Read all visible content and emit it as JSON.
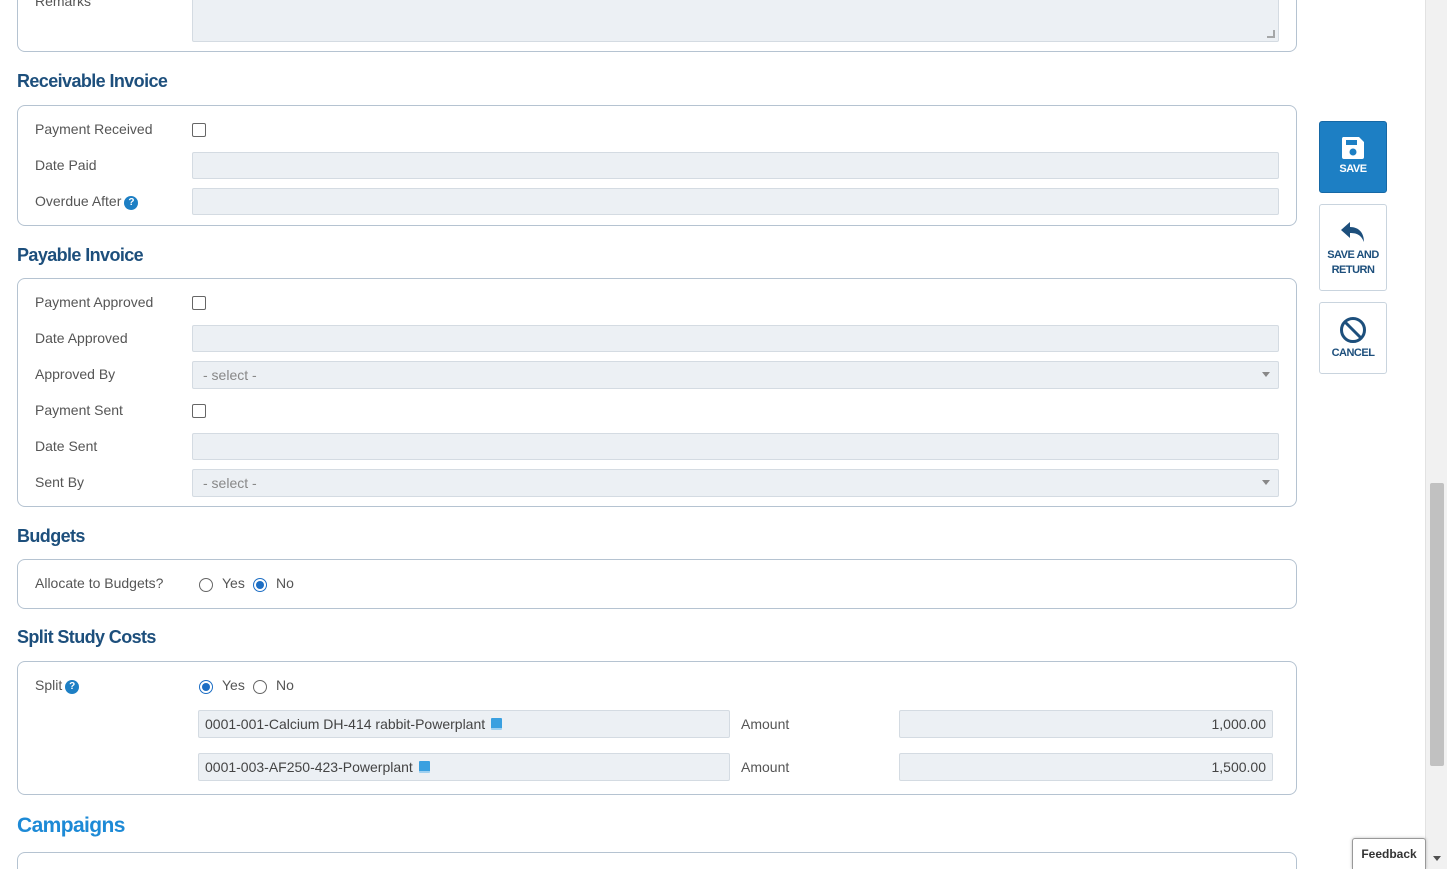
{
  "remarks": {
    "label": "Remarks"
  },
  "receivable": {
    "title": "Receivable Invoice",
    "payment_received": "Payment Received",
    "date_paid": "Date Paid",
    "overdue_after": "Overdue After"
  },
  "payable": {
    "title": "Payable Invoice",
    "payment_approved": "Payment Approved",
    "date_approved": "Date Approved",
    "approved_by": "Approved By",
    "approved_by_value": "- select -",
    "payment_sent": "Payment Sent",
    "date_sent": "Date Sent",
    "sent_by": "Sent By",
    "sent_by_value": "- select -"
  },
  "budgets": {
    "title": "Budgets",
    "allocate_label": "Allocate to Budgets?",
    "yes": "Yes",
    "no": "No",
    "selected": "No"
  },
  "split": {
    "title": "Split Study Costs",
    "label": "Split",
    "yes": "Yes",
    "no": "No",
    "selected": "Yes",
    "rows": [
      {
        "study": "0001-001-Calcium DH-414 rabbit-Powerplant",
        "amount_label": "Amount",
        "amount": "1,000.00"
      },
      {
        "study": "0001-003-AF250-423-Powerplant",
        "amount_label": "Amount",
        "amount": "1,500.00"
      }
    ]
  },
  "campaigns": {
    "title": "Campaigns"
  },
  "actions": {
    "save": "SAVE",
    "save_and_return_1": "SAVE AND",
    "save_and_return_2": "RETURN",
    "cancel": "CANCEL"
  },
  "feedback": "Feedback",
  "colors": {
    "accent": "#1d7fc4",
    "heading": "#1d4f7c",
    "field_bg": "#ecf0f4"
  }
}
